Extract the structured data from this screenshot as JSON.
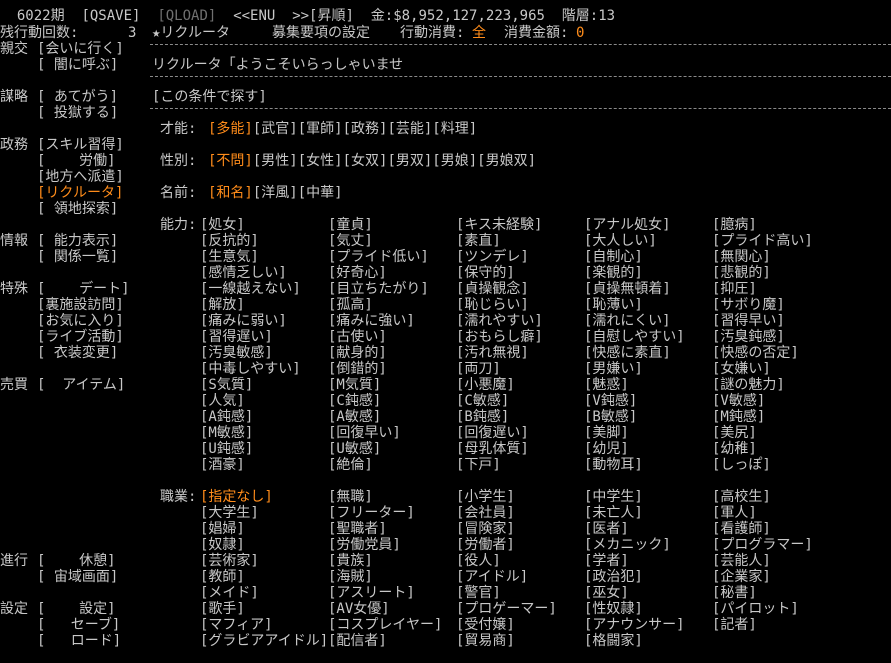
{
  "top_bar": {
    "day": "6022",
    "day_suffix": "期",
    "qsave": "[QSAVE]",
    "qload": "[QLOAD]",
    "nav": "<<ENU  >>",
    "sort": "[昇順]",
    "money_label": "金:",
    "money": "$8,952,127,223,965",
    "floor_label": "階層:",
    "floor": "13"
  },
  "sidebar": {
    "actions_label": "残行動回数:",
    "actions_value": "3",
    "groups": [
      {
        "label": "親交",
        "items": [
          "[会いに行く]",
          "[ 闇に呼ぶ]"
        ]
      },
      {
        "label": "謀略",
        "items": [
          "[ あてがう]",
          "[ 投獄する]"
        ]
      },
      {
        "label": "政務",
        "items": [
          "[スキル習得]",
          "[    労働]",
          "[地方へ派遣]",
          "[リクルータ]",
          "[ 領地探索]"
        ]
      },
      {
        "label": "情報",
        "items": [
          "[ 能力表示]",
          "[ 関係一覧]"
        ]
      },
      {
        "label": "特殊",
        "items": [
          "[    デート]",
          "[裏施設訪問]",
          "[お気に入り]",
          "[ライブ活動]",
          "[ 衣装変更]"
        ]
      },
      {
        "label": "売買",
        "items": [
          "[  アイテム]"
        ]
      },
      {
        "label": "進行",
        "items": [
          "[    休憩]",
          "[ 宙域画面]"
        ]
      },
      {
        "label": "設定",
        "items": [
          "[    設定]",
          "[   セーブ]",
          "[   ロード]"
        ]
      }
    ]
  },
  "header": {
    "title": "★リクルータ",
    "settings_label": "募集要項の設定",
    "action_cost_label": "行動消費:",
    "action_cost_value": "全",
    "spend_label": "消費金額:",
    "spend_value": "0"
  },
  "message": "リクルータ「ようこそいらっしゃいませ",
  "search_button": "[この条件で探す]",
  "talent": {
    "label": "才能:",
    "options": [
      "[多能]",
      "[武官]",
      "[軍師]",
      "[政務]",
      "[芸能]",
      "[料理]"
    ],
    "selected": 0
  },
  "gender": {
    "label": "性別:",
    "options": [
      "[不問]",
      "[男性]",
      "[女性]",
      "[女双]",
      "[男双]",
      "[男娘]",
      "[男娘双]"
    ],
    "selected": 0
  },
  "name_style": {
    "label": "名前:",
    "options": [
      "[和名]",
      "[洋風]",
      "[中華]"
    ],
    "selected": 0
  },
  "abilities": {
    "label": "能力:",
    "items": [
      "[処女]",
      "[童貞]",
      "[キス未経験]",
      "[アナル処女]",
      "[臆病]",
      "[反抗的]",
      "[気丈]",
      "[素直]",
      "[大人しい]",
      "[プライド高い]",
      "[生意気]",
      "[プライド低い]",
      "[ツンデレ]",
      "[自制心]",
      "[無関心]",
      "[感情乏しい]",
      "[好奇心]",
      "[保守的]",
      "[楽観的]",
      "[悲観的]",
      "[一線越えない]",
      "[目立ちたがり]",
      "[貞操観念]",
      "[貞操無頓着]",
      "[抑圧]",
      "[解放]",
      "[孤高]",
      "[恥じらい]",
      "[恥薄い]",
      "[サボり魔]",
      "[痛みに弱い]",
      "[痛みに強い]",
      "[濡れやすい]",
      "[濡れにくい]",
      "[習得早い]",
      "[習得遅い]",
      "[古使い]",
      "[おもらし癖]",
      "[自慰しやすい]",
      "[汚臭鈍感]",
      "[汚臭敏感]",
      "[献身的]",
      "[汚れ無視]",
      "[快感に素直]",
      "[快感の否定]",
      "[中毒しやすい]",
      "[倒錯的]",
      "[両刀]",
      "[男嫌い]",
      "[女嫌い]",
      "[S気質]",
      "[M気質]",
      "[小悪魔]",
      "[魅惑]",
      "[謎の魅力]",
      "[人気]",
      "[C鈍感]",
      "[C敏感]",
      "[V鈍感]",
      "[V敏感]",
      "[A鈍感]",
      "[A敏感]",
      "[B鈍感]",
      "[B敏感]",
      "[M鈍感]",
      "[M敏感]",
      "[回復早い]",
      "[回復遅い]",
      "[美脚]",
      "[美尻]",
      "[U鈍感]",
      "[U敏感]",
      "[母乳体質]",
      "[幼児]",
      "[幼稚]",
      "[酒豪]",
      "[絶倫]",
      "[下戸]",
      "[動物耳]",
      "[しっぽ]"
    ]
  },
  "jobs": {
    "label": "職業:",
    "selected": 0,
    "items": [
      "[指定なし]",
      "[無職]",
      "[小学生]",
      "[中学生]",
      "[高校生]",
      "[大学生]",
      "[フリーター]",
      "[会社員]",
      "[未亡人]",
      "[軍人]",
      "[娼婦]",
      "[聖職者]",
      "[冒険家]",
      "[医者]",
      "[看護師]",
      "[奴隷]",
      "[労働党員]",
      "[労働者]",
      "[メカニック]",
      "[プログラマー]",
      "[芸術家]",
      "[貴族]",
      "[役人]",
      "[学者]",
      "[芸能人]",
      "[教師]",
      "[海賊]",
      "[アイドル]",
      "[政治犯]",
      "[企業家]",
      "[メイド]",
      "[アスリート]",
      "[警官]",
      "[巫女]",
      "[秘書]",
      "[歌手]",
      "[AV女優]",
      "[プロゲーマー]",
      "[性奴隷]",
      "[パイロット]",
      "[マフィア]",
      "[コスプレイヤー]",
      "[受付嬢]",
      "[アナウンサー]",
      "[記者]",
      "[グラビアアイドル]",
      "[配信者]",
      "[貿易商]",
      "[格闘家]",
      ""
    ]
  },
  "colors": {
    "background": "#000000",
    "text": "#c8c8c8",
    "highlight": "#ff8c1a",
    "dim": "#707070"
  }
}
